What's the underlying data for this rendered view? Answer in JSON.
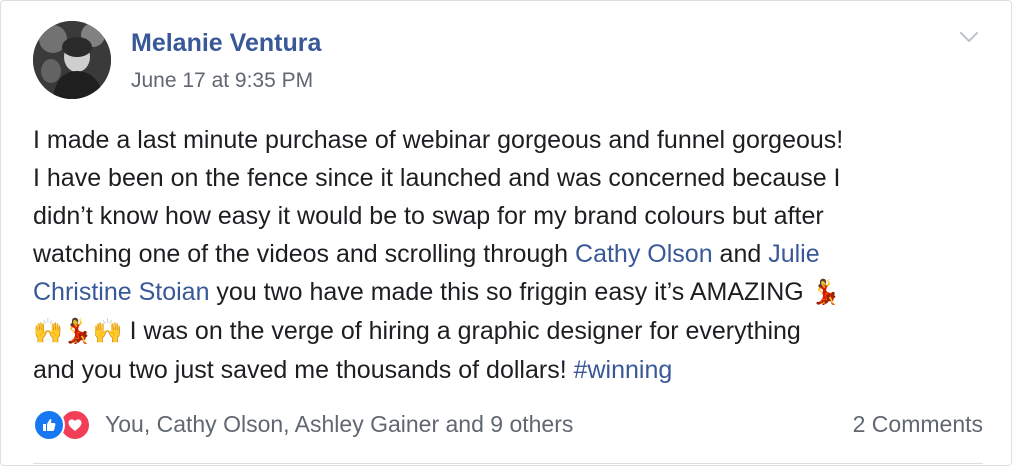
{
  "post": {
    "author": "Melanie Ventura",
    "timestamp": "June 17 at 9:35 PM",
    "body": {
      "line1": "I made a last minute purchase of webinar gorgeous and funnel gorgeous!",
      "line2": "I have been on the fence since it launched and was concerned because I",
      "line3": "didn’t know how easy it would be to swap for my brand colours but after",
      "line4_text": "watching one of the videos and scrolling through ",
      "mention1": "Cathy Olson",
      "line4_and": " and ",
      "mention2_part1": "Julie",
      "mention2_part2": "Christine Stoian",
      "line5_text": " you two have made this so friggin easy it’s AMAZING ",
      "emoji_dancer": "💃",
      "emoji_hands": "🙌",
      "line6_text": " I was on the verge of hiring a graphic designer for everything",
      "line7_text": "and you two just saved me thousands of dollars! ",
      "hashtag": "#winning"
    },
    "reactions": {
      "icons": [
        "like-icon",
        "love-icon"
      ],
      "summary": "You, Cathy Olson, Ashley Gainer and 9 others"
    },
    "comments_label": "2 Comments",
    "colors": {
      "link": "#385898",
      "meta": "#606770",
      "like": "#1877f2",
      "love": "#f33e58"
    }
  }
}
